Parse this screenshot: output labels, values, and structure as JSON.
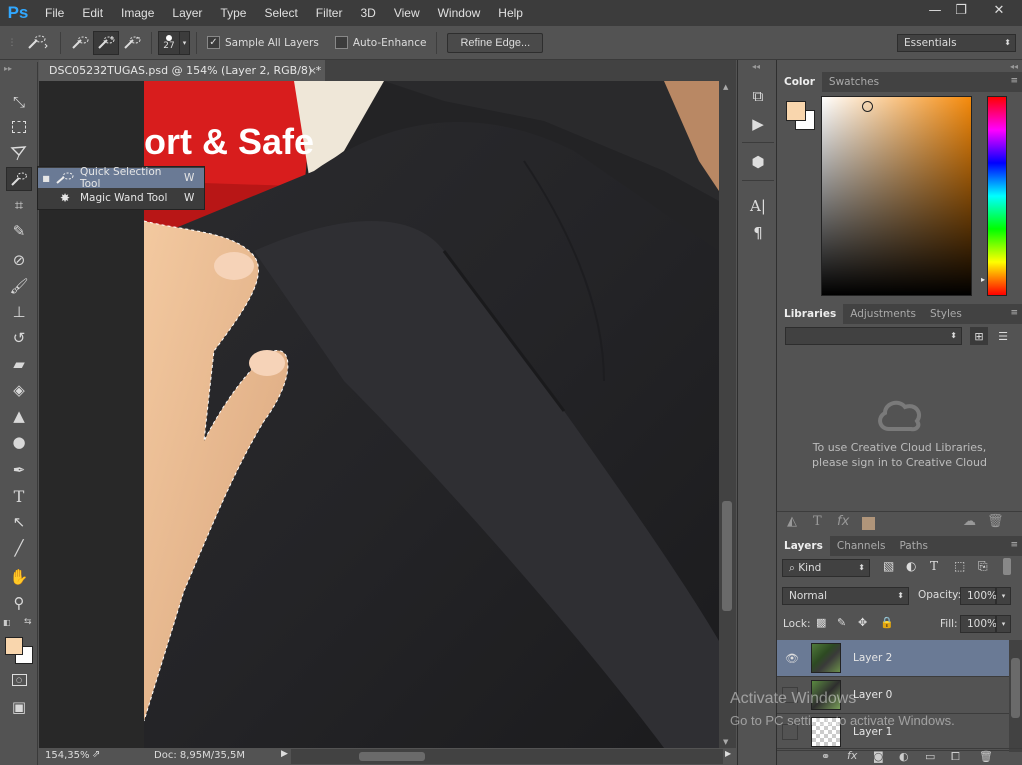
{
  "app": {
    "logo": "Ps"
  },
  "menu": [
    "File",
    "Edit",
    "Image",
    "Layer",
    "Type",
    "Select",
    "Filter",
    "3D",
    "View",
    "Window",
    "Help"
  ],
  "window_controls": {
    "minimize": "—",
    "restore": "❐",
    "close": "✕"
  },
  "options_bar": {
    "brush_size": "27",
    "sample_all_layers_label": "Sample All Layers",
    "sample_all_layers_checked": true,
    "auto_enhance_label": "Auto-Enhance",
    "auto_enhance_checked": false,
    "refine_edge_label": "Refine Edge...",
    "workspace": "Essentials"
  },
  "document": {
    "tab_title": "DSC05232TUGAS.psd @ 154% (Layer 2, RGB/8) *",
    "close": "×",
    "photo_text": "ort & Safe"
  },
  "status": {
    "zoom": "154,35%",
    "doc": "Doc: 8,95M/35,5M"
  },
  "tool_flyout": [
    {
      "label": "Quick Selection Tool",
      "shortcut": "W",
      "active": true
    },
    {
      "label": "Magic Wand Tool",
      "shortcut": "W",
      "active": false
    }
  ],
  "panels": {
    "color_tabs": [
      "Color",
      "Swatches"
    ],
    "foreground_color": "#f9d6ad",
    "background_color": "#ffffff",
    "libraries_tabs": [
      "Libraries",
      "Adjustments",
      "Styles"
    ],
    "libraries_message_1": "To use Creative Cloud Libraries,",
    "libraries_message_2": "please sign in to Creative Cloud",
    "layers_tabs": [
      "Layers",
      "Channels",
      "Paths"
    ],
    "filter_kind": "Kind",
    "blend_mode": "Normal",
    "opacity_label": "Opacity:",
    "opacity_value": "100%",
    "lock_label": "Lock:",
    "fill_label": "Fill:",
    "fill_value": "100%",
    "layers": [
      {
        "name": "Layer 2",
        "selected": true,
        "visible": true
      },
      {
        "name": "Layer 0",
        "selected": false,
        "visible": false
      },
      {
        "name": "Layer 1",
        "selected": false,
        "visible": false
      }
    ]
  },
  "watermark": {
    "line1": "Activate Windows",
    "line2": "Go to PC settings to activate Windows."
  }
}
